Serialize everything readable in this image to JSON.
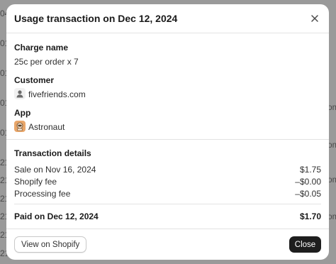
{
  "background": {
    "left_fragments": [
      "04",
      "01",
      "01",
      "01",
      "01",
      "21",
      "21",
      "21",
      "21",
      "21",
      "21"
    ],
    "right_fragments": [
      "om",
      "om",
      "om",
      "om"
    ]
  },
  "modal": {
    "title": "Usage transaction on Dec 12, 2024",
    "close_icon": "close-icon",
    "charge": {
      "label": "Charge name",
      "value": "25c per order x 7"
    },
    "customer": {
      "label": "Customer",
      "value": "fivefriends.com",
      "icon": "person-icon"
    },
    "app": {
      "label": "App",
      "value": "Astronaut",
      "icon": "astronaut-app-icon"
    },
    "details": {
      "label": "Transaction details",
      "rows": [
        {
          "label": "Sale on Nov 16, 2024",
          "amount": "$1.75"
        },
        {
          "label": "Shopify fee",
          "amount": "–$0.00"
        },
        {
          "label": "Processing fee",
          "amount": "–$0.05"
        }
      ],
      "total": {
        "label": "Paid on Dec 12, 2024",
        "amount": "$1.70"
      }
    },
    "footer": {
      "secondary_label": "View on Shopify",
      "primary_label": "Close"
    }
  },
  "colors": {
    "overlay": "#9a9a9a",
    "primary_button": "#1e1e1e",
    "app_icon_bg": "#e8a66a"
  }
}
